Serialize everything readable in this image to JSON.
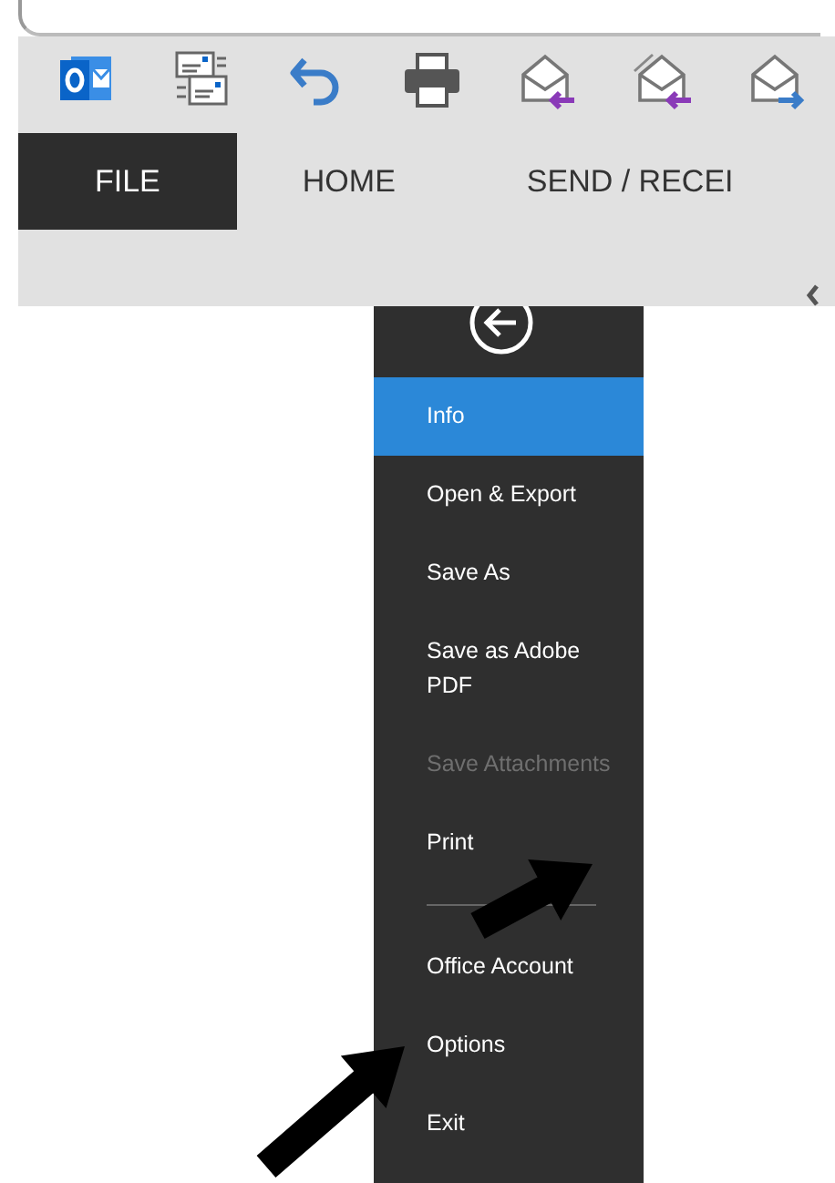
{
  "tabs": [
    {
      "label": "FILE",
      "selected": true
    },
    {
      "label": "HOME",
      "selected": false
    },
    {
      "label": "SEND / RECEI",
      "selected": false
    }
  ],
  "backstage_menu": [
    {
      "kind": "item",
      "label": "Info",
      "selected": true,
      "disabled": false
    },
    {
      "kind": "item",
      "label": "Open & Export",
      "selected": false,
      "disabled": false
    },
    {
      "kind": "item",
      "label": "Save As",
      "selected": false,
      "disabled": false
    },
    {
      "kind": "item",
      "label": "Save as Adobe PDF",
      "selected": false,
      "disabled": false
    },
    {
      "kind": "item",
      "label": "Save Attachments",
      "selected": false,
      "disabled": true
    },
    {
      "kind": "item",
      "label": "Print",
      "selected": false,
      "disabled": false
    },
    {
      "kind": "divider"
    },
    {
      "kind": "item",
      "label": "Office Account",
      "selected": false,
      "disabled": false
    },
    {
      "kind": "item",
      "label": "Options",
      "selected": false,
      "disabled": false
    },
    {
      "kind": "item",
      "label": "Exit",
      "selected": false,
      "disabled": false
    }
  ]
}
